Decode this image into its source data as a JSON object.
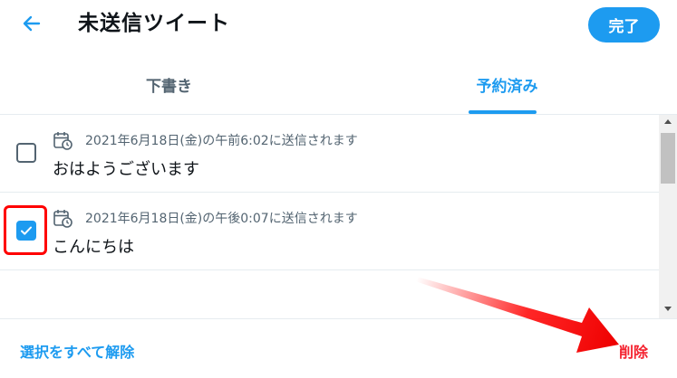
{
  "header": {
    "back_icon": "arrow-left-icon",
    "title": "未送信ツイート",
    "done_label": "完了"
  },
  "tabs": [
    {
      "label": "下書き",
      "active": false
    },
    {
      "label": "予約済み",
      "active": true
    }
  ],
  "scheduled": [
    {
      "checked": false,
      "scheduled_text": "2021年6月18日(金)の午前6:02に送信されます",
      "tweet_text": "おはようございます",
      "icon": "calendar-clock-icon"
    },
    {
      "checked": true,
      "scheduled_text": "2021年6月18日(金)の午後0:07に送信されます",
      "tweet_text": "こんにちは",
      "icon": "calendar-clock-icon"
    }
  ],
  "footer": {
    "deselect_all_label": "選択をすべて解除",
    "delete_label": "削除"
  },
  "colors": {
    "accent": "#1d9bf0",
    "danger": "#f4212e",
    "annotation": "#ff0000"
  }
}
